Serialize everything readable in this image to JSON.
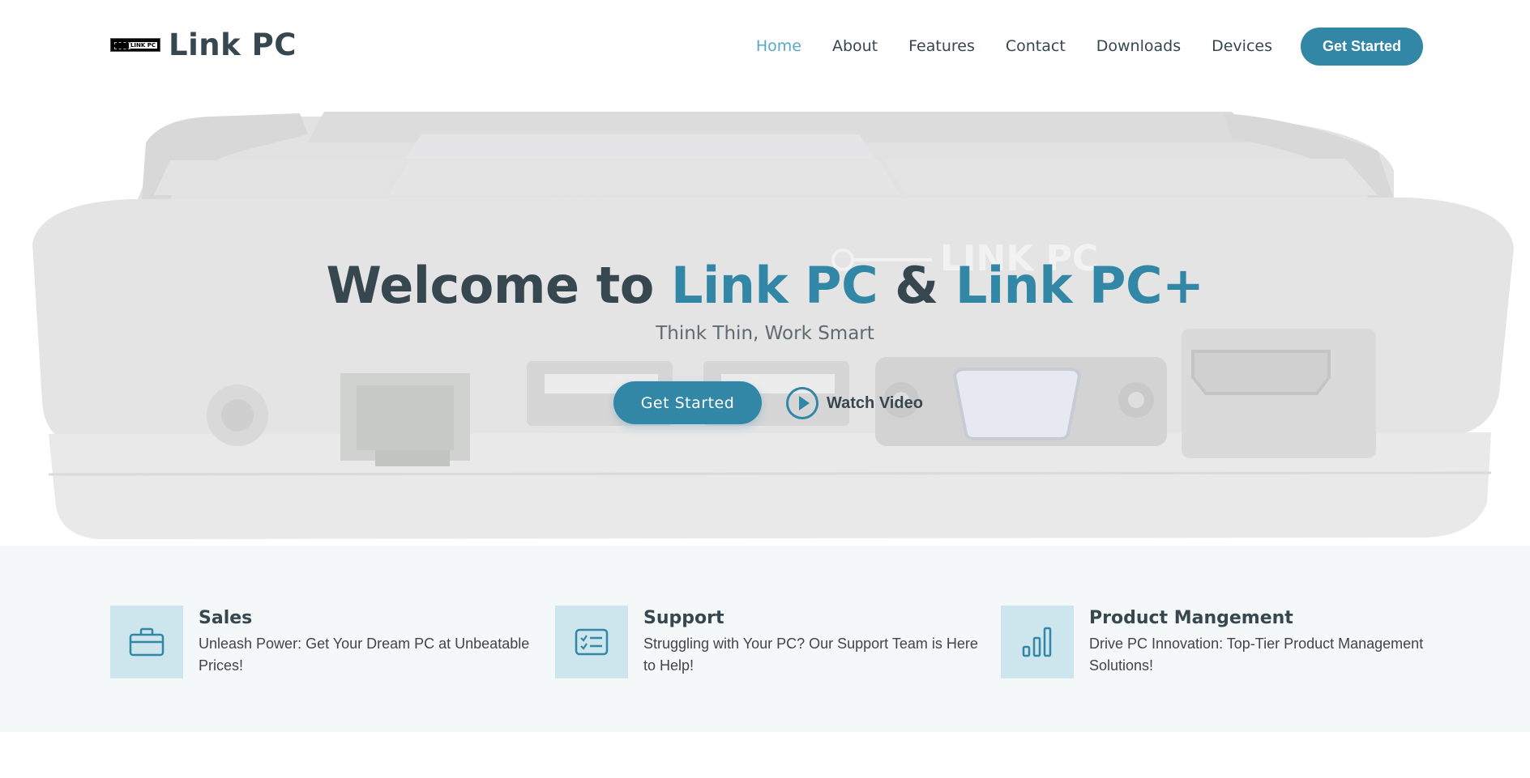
{
  "brand": {
    "logo_mark_text": "LINK PC",
    "name": "Link PC"
  },
  "nav": {
    "items": [
      {
        "label": "Home"
      },
      {
        "label": "About"
      },
      {
        "label": "Features"
      },
      {
        "label": "Contact"
      },
      {
        "label": "Downloads"
      },
      {
        "label": "Devices"
      }
    ],
    "cta_label": "Get Started"
  },
  "hero": {
    "title_part1": "Welcome to ",
    "title_accent1": "Link PC",
    "title_amp": " & ",
    "title_accent2": "Link PC+",
    "subtitle": "Think Thin, Work Smart",
    "cta_label": "Get Started",
    "watch_label": "Watch Video",
    "device_engraving": "LINK PC"
  },
  "features": [
    {
      "icon": "briefcase-icon",
      "title": "Sales",
      "desc_line1": "Unleash Power: Get Your Dream PC at Unbeatable",
      "desc_line2": "Prices!"
    },
    {
      "icon": "checklist-icon",
      "title": "Support",
      "desc_line1": "Struggling with Your PC? Our Support Team is Here",
      "desc_line2": "to Help!"
    },
    {
      "icon": "bar-chart-icon",
      "title": "Product Mangement",
      "desc_line1": "Drive PC Innovation: Top-Tier Product Management",
      "desc_line2": "Solutions!"
    }
  ],
  "colors": {
    "accent": "#3287a6",
    "nav_active": "#5aa8c8",
    "text_dark": "#37474f",
    "icon_bg": "#cde5ec",
    "features_bg": "#f4f8f9"
  }
}
